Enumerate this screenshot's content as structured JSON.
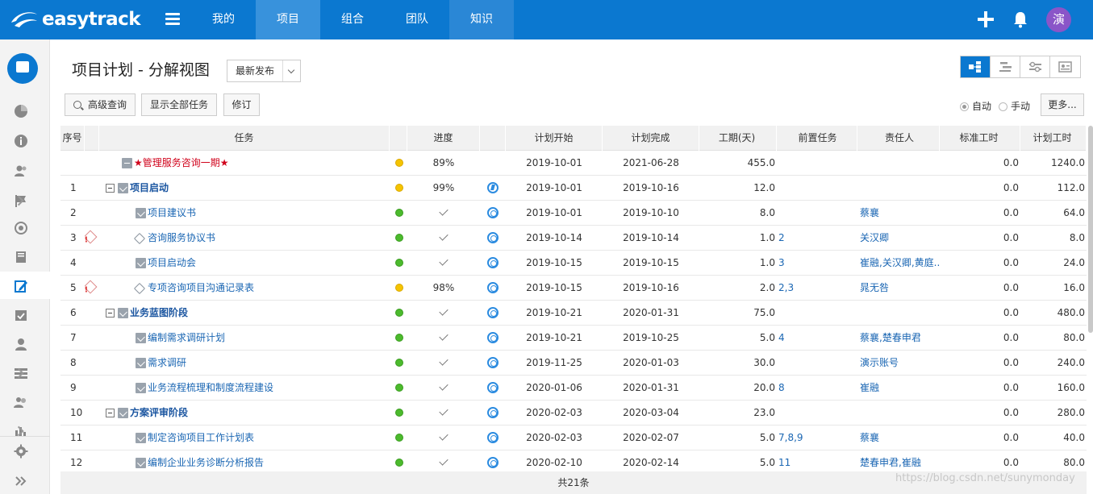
{
  "app": {
    "name": "easytrack"
  },
  "nav": [
    {
      "label": "我的"
    },
    {
      "label": "项目"
    },
    {
      "label": "组合"
    },
    {
      "label": "团队"
    },
    {
      "label": "知识"
    }
  ],
  "user": {
    "avatar_char": "演"
  },
  "page": {
    "title": "项目计划 - 分解视图",
    "version": "最新发布"
  },
  "toolbar": {
    "advanced_search": "高级查询",
    "show_all": "显示全部任务",
    "revise": "修订",
    "auto": "自动",
    "manual": "手动",
    "more": "更多..."
  },
  "columns": {
    "seq": "序号",
    "task": "任务",
    "progress": "进度",
    "start": "计划开始",
    "end": "计划完成",
    "duration": "工期(天)",
    "predecessor": "前置任务",
    "owner": "责任人",
    "std_hours": "标准工时",
    "plan_hours": "计划工时"
  },
  "rows": [
    {
      "seq": "",
      "warn": false,
      "level": 0,
      "icon": "doc",
      "name": "★管理服务咨询一期★",
      "dot": "yellow",
      "progress": "89%",
      "flag": "",
      "start": "2019-10-01",
      "end": "2021-06-28",
      "duration": "455.0",
      "pred": "",
      "owner": "",
      "std": "0.0",
      "plan": "1240.0"
    },
    {
      "seq": "1",
      "warn": false,
      "level": 1,
      "icon": "task",
      "name": "项目启动",
      "dot": "yellow",
      "progress": "99%",
      "flag": "bolt",
      "start": "2019-10-01",
      "end": "2019-10-16",
      "duration": "12.0",
      "pred": "",
      "owner": "",
      "std": "0.0",
      "plan": "112.0"
    },
    {
      "seq": "2",
      "warn": false,
      "level": 2,
      "icon": "task",
      "name": "项目建议书",
      "dot": "green",
      "progress": "",
      "flag": "ring",
      "start": "2019-10-01",
      "end": "2019-10-10",
      "duration": "8.0",
      "pred": "",
      "owner": "蔡襄",
      "std": "0.0",
      "plan": "64.0"
    },
    {
      "seq": "3",
      "warn": true,
      "level": 2,
      "icon": "diamond",
      "name": "咨询服务协议书",
      "dot": "green",
      "progress": "",
      "flag": "ring",
      "start": "2019-10-14",
      "end": "2019-10-14",
      "duration": "1.0",
      "pred": "2",
      "owner": "关汉卿",
      "std": "0.0",
      "plan": "8.0"
    },
    {
      "seq": "4",
      "warn": false,
      "level": 2,
      "icon": "task",
      "name": "项目启动会",
      "dot": "green",
      "progress": "",
      "flag": "ring",
      "start": "2019-10-15",
      "end": "2019-10-15",
      "duration": "1.0",
      "pred": "3",
      "owner": "崔融,关汉卿,黄庭...",
      "std": "0.0",
      "plan": "24.0"
    },
    {
      "seq": "5",
      "warn": true,
      "level": 2,
      "icon": "diamond",
      "name": "专项咨询项目沟通记录表",
      "dot": "yellow",
      "progress": "98%",
      "flag": "ring",
      "start": "2019-10-15",
      "end": "2019-10-16",
      "duration": "2.0",
      "pred": "2,3",
      "owner": "晁无咎",
      "std": "0.0",
      "plan": "16.0"
    },
    {
      "seq": "6",
      "warn": false,
      "level": 1,
      "icon": "task",
      "name": "业务蓝图阶段",
      "dot": "green",
      "progress": "",
      "flag": "ring",
      "start": "2019-10-21",
      "end": "2020-01-31",
      "duration": "75.0",
      "pred": "",
      "owner": "",
      "std": "0.0",
      "plan": "480.0"
    },
    {
      "seq": "7",
      "warn": false,
      "level": 2,
      "icon": "task",
      "name": "编制需求调研计划",
      "dot": "green",
      "progress": "",
      "flag": "ring",
      "start": "2019-10-21",
      "end": "2019-10-25",
      "duration": "5.0",
      "pred": "4",
      "owner": "蔡襄,楚春申君",
      "std": "0.0",
      "plan": "80.0"
    },
    {
      "seq": "8",
      "warn": false,
      "level": 2,
      "icon": "task",
      "name": "需求调研",
      "dot": "green",
      "progress": "",
      "flag": "ring",
      "start": "2019-11-25",
      "end": "2020-01-03",
      "duration": "30.0",
      "pred": "",
      "owner": "演示账号",
      "std": "0.0",
      "plan": "240.0"
    },
    {
      "seq": "9",
      "warn": false,
      "level": 2,
      "icon": "task",
      "name": "业务流程梳理和制度流程建设",
      "dot": "green",
      "progress": "",
      "flag": "ring",
      "start": "2020-01-06",
      "end": "2020-01-31",
      "duration": "20.0",
      "pred": "8",
      "owner": "崔融",
      "std": "0.0",
      "plan": "160.0"
    },
    {
      "seq": "10",
      "warn": false,
      "level": 1,
      "icon": "task",
      "name": "方案评审阶段",
      "dot": "green",
      "progress": "",
      "flag": "ring",
      "start": "2020-02-03",
      "end": "2020-03-04",
      "duration": "23.0",
      "pred": "",
      "owner": "",
      "std": "0.0",
      "plan": "280.0"
    },
    {
      "seq": "11",
      "warn": false,
      "level": 2,
      "icon": "task",
      "name": "制定咨询项目工作计划表",
      "dot": "green",
      "progress": "",
      "flag": "ring",
      "start": "2020-02-03",
      "end": "2020-02-07",
      "duration": "5.0",
      "pred": "7,8,9",
      "owner": "蔡襄",
      "std": "0.0",
      "plan": "40.0"
    },
    {
      "seq": "12",
      "warn": false,
      "level": 2,
      "icon": "task",
      "name": "编制企业业务诊断分析报告",
      "dot": "green",
      "progress": "",
      "flag": "ring",
      "start": "2020-02-10",
      "end": "2020-02-14",
      "duration": "5.0",
      "pred": "11",
      "owner": "楚春申君,崔融",
      "std": "0.0",
      "plan": "80.0"
    }
  ],
  "footer": {
    "total": "共21条"
  },
  "watermark": "https://blog.csdn.net/sunymonday",
  "colors": {
    "brand": "#0b78d0",
    "root_task": "#d0021b",
    "link": "#1a66b3"
  }
}
